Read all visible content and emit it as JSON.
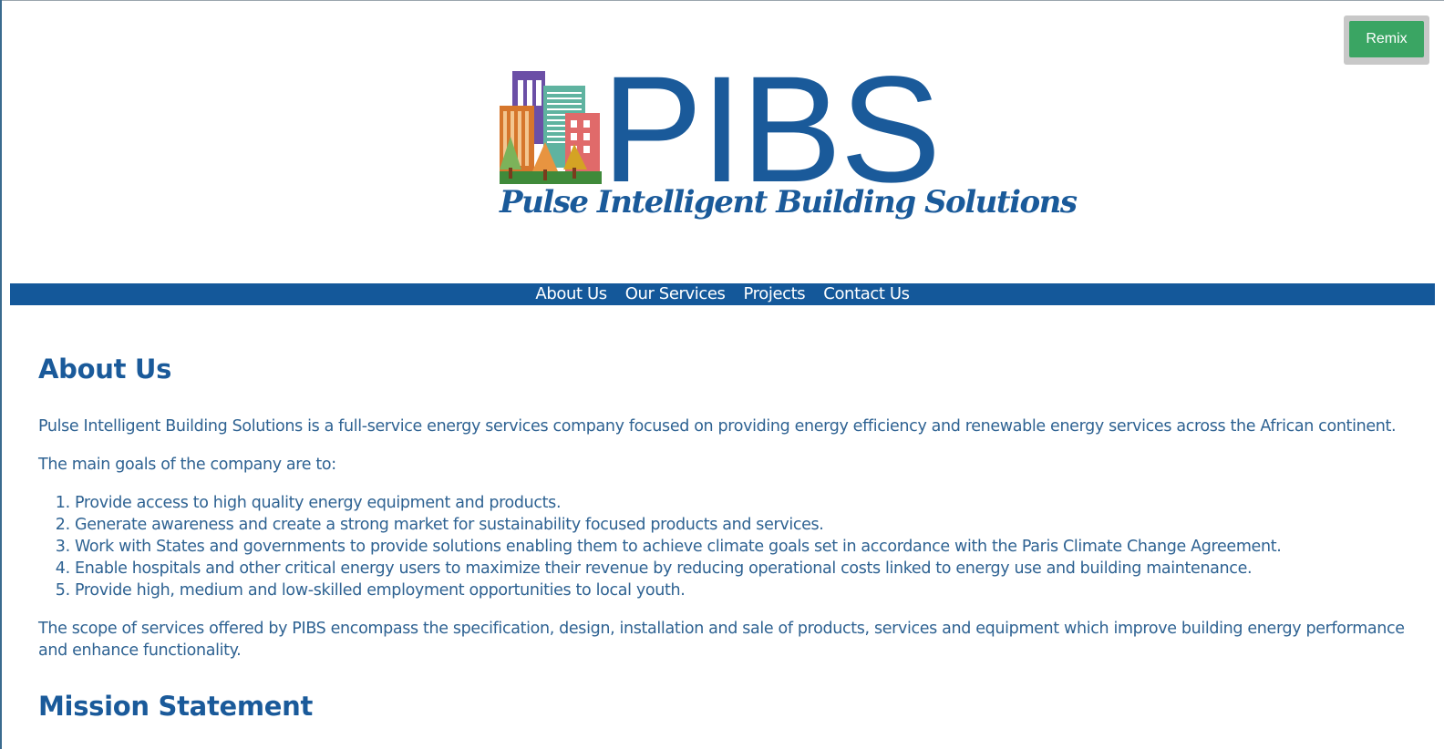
{
  "remix": {
    "label": "Remix"
  },
  "logo": {
    "wordmark": "PIBS",
    "tagline": "Pulse Intelligent Building Solutions"
  },
  "nav": {
    "items": [
      {
        "label": "About Us"
      },
      {
        "label": "Our Services"
      },
      {
        "label": "Projects"
      },
      {
        "label": "Contact Us"
      }
    ]
  },
  "about": {
    "heading": "About Us",
    "intro": "Pulse Intelligent Building Solutions is a full-service energy services company focused on providing energy efficiency and renewable energy services across the African continent.",
    "goals_intro": "The main goals of the company are to:",
    "goals": [
      "Provide access to high quality energy equipment and products.",
      "Generate awareness and create a strong market for sustainability focused products and services.",
      "Work with States and governments to provide solutions enabling them to achieve climate goals set in accordance with the Paris Climate Change Agreement.",
      "Enable hospitals and other critical energy users to maximize their revenue by reducing operational costs linked to energy use and building maintenance.",
      "Provide high, medium and low-skilled employment opportunities to local youth."
    ],
    "scope": "The scope of services offered by PIBS encompass the specification, design, installation and sale of products, services and equipment which improve building energy performance and enhance functionality."
  },
  "mission": {
    "heading": "Mission Statement"
  },
  "colors": {
    "brand_blue": "#14589a",
    "remix_green": "#3aa563",
    "text_blue": "#2e6292"
  }
}
